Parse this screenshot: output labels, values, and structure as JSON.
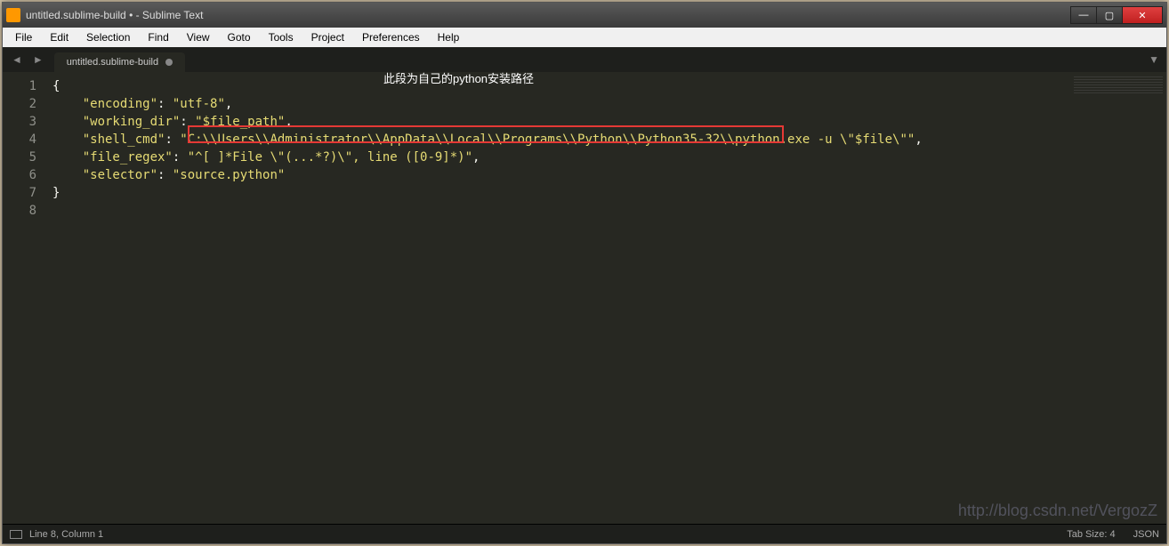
{
  "window": {
    "title": "untitled.sublime-build • - Sublime Text"
  },
  "menu": {
    "items": [
      "File",
      "Edit",
      "Selection",
      "Find",
      "View",
      "Goto",
      "Tools",
      "Project",
      "Preferences",
      "Help"
    ]
  },
  "tabs": {
    "nav_left": "◄",
    "nav_right": "►",
    "dropdown": "▼",
    "active": {
      "label": "untitled.sublime-build"
    }
  },
  "gutter": {
    "lines": [
      "1",
      "2",
      "3",
      "4",
      "5",
      "6",
      "7",
      "8"
    ]
  },
  "code": {
    "l1_open": "{",
    "l2_key": "\"encoding\"",
    "l2_val": "\"utf-8\"",
    "l3_key": "\"working_dir\"",
    "l3_val": "\"$file_path\"",
    "l4_key": "\"shell_cmd\"",
    "l4_val_pre": "\"",
    "l4_val_hl": "C:\\\\Users\\\\Administrator\\\\AppData\\\\Local\\\\Programs\\\\Python\\\\Python35-32\\\\",
    "l4_val_post": "python.exe -u \\\"$file\\\"\"",
    "l5_key": "\"file_regex\"",
    "l5_val": "\"^[ ]*File \\\"(...*?)\\\", line ([0-9]*)\"",
    "l6_key": "\"selector\"",
    "l6_val": "\"source.python\"",
    "l7_close": "}"
  },
  "annotation": {
    "text": "此段为自己的python安装路径"
  },
  "status": {
    "position": "Line 8, Column 1",
    "tabsize": "Tab Size: 4",
    "syntax": "JSON"
  },
  "watermark": "http://blog.csdn.net/VergozZ"
}
